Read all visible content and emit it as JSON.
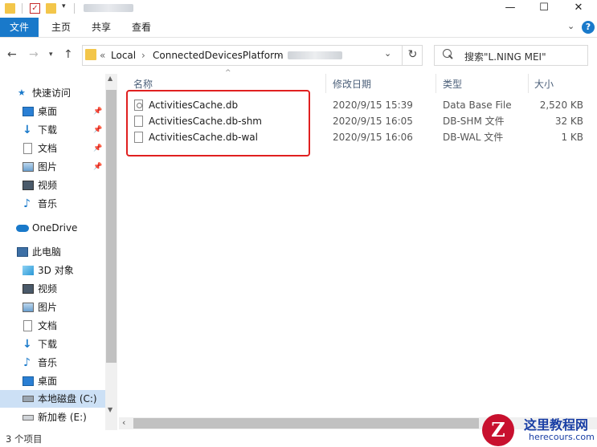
{
  "ribbon": {
    "tabs": [
      {
        "label": "文件",
        "active": true
      },
      {
        "label": "主页"
      },
      {
        "label": "共享"
      },
      {
        "label": "查看"
      }
    ],
    "help": "?"
  },
  "window": {
    "minimize": "—",
    "maximize": "☐",
    "close": "✕"
  },
  "address": {
    "prefix": "«",
    "segments": [
      "Local",
      "ConnectedDevicesPlatform"
    ],
    "separator": "›"
  },
  "search": {
    "placeholder": "搜索\"L.NING MEI\""
  },
  "nav": {
    "quick_access": "快速访问",
    "items_quick": [
      {
        "label": "桌面",
        "icon": "desktop-icon",
        "pinned": true
      },
      {
        "label": "下载",
        "icon": "download-icon",
        "pinned": true
      },
      {
        "label": "文档",
        "icon": "document-icon",
        "pinned": true
      },
      {
        "label": "图片",
        "icon": "picture-icon",
        "pinned": true
      },
      {
        "label": "视频",
        "icon": "video-icon",
        "pinned": false
      },
      {
        "label": "音乐",
        "icon": "music-icon",
        "pinned": false
      }
    ],
    "onedrive": "OneDrive",
    "this_pc": "此电脑",
    "items_pc": [
      {
        "label": "3D 对象",
        "icon": "3d-objects-icon"
      },
      {
        "label": "视频",
        "icon": "video-icon"
      },
      {
        "label": "图片",
        "icon": "picture-icon"
      },
      {
        "label": "文档",
        "icon": "document-icon"
      },
      {
        "label": "下载",
        "icon": "download-icon"
      },
      {
        "label": "音乐",
        "icon": "music-icon"
      },
      {
        "label": "桌面",
        "icon": "desktop-icon"
      },
      {
        "label": "本地磁盘 (C:)",
        "icon": "local-disk-icon",
        "selected": true
      },
      {
        "label": "新加卷 (E:)",
        "icon": "drive-icon"
      }
    ]
  },
  "columns": {
    "name": "名称",
    "modified": "修改日期",
    "type": "类型",
    "size": "大小"
  },
  "files": [
    {
      "name": "ActivitiesCache.db",
      "modified": "2020/9/15 15:39",
      "type": "Data Base File",
      "size": "2,520 KB",
      "icon": "database-file-icon"
    },
    {
      "name": "ActivitiesCache.db-shm",
      "modified": "2020/9/15 16:05",
      "type": "DB-SHM 文件",
      "size": "32 KB",
      "icon": "file-icon"
    },
    {
      "name": "ActivitiesCache.db-wal",
      "modified": "2020/9/15 16:06",
      "type": "DB-WAL 文件",
      "size": "1 KB",
      "icon": "file-icon"
    }
  ],
  "status": {
    "count": "3 个项目"
  },
  "watermark": {
    "logo": "Z",
    "title": "这里教程网",
    "url": "herecours.com"
  },
  "colors": {
    "accent": "#1979ca",
    "highlight_border": "#e02020",
    "selected_bg": "#cce0f5"
  }
}
